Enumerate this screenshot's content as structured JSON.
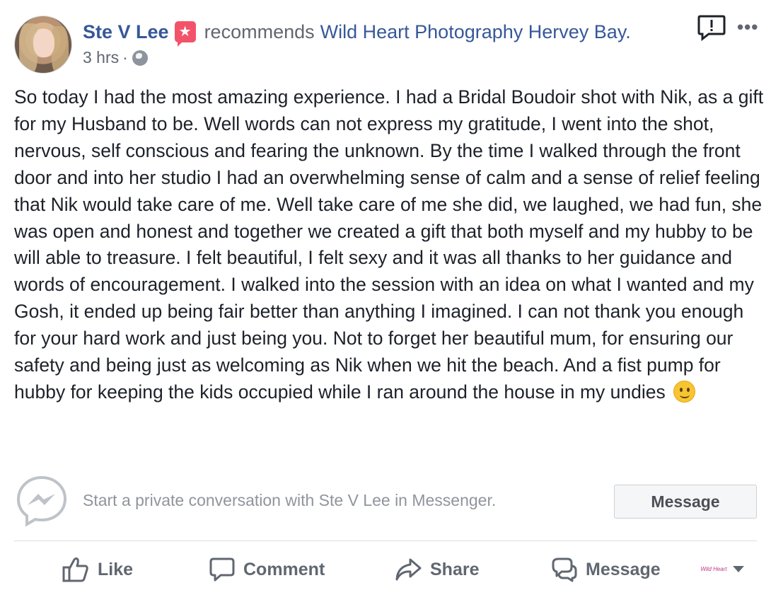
{
  "post": {
    "author": "Ste V Lee",
    "action": "recommends",
    "page": "Wild Heart Photography Hervey Bay.",
    "time": "3 hrs",
    "separator": "·",
    "body": "So today I had the most amazing experience. I had a Bridal Boudoir shot with Nik, as a gift for my Husband to be. Well words can not express my gratitude, I went into the shot, nervous, self conscious and fearing the unknown. By the time I walked through the front door and into her studio I had an overwhelming sense of calm and a sense of relief feeling that Nik would take care of me. Well take care of me she did, we laughed, we had fun, she was open and honest and together we created a gift that both myself and my hubby to be will able to treasure. I felt beautiful, I felt sexy and it was all thanks to her guidance and words of encouragement. I walked into the session with an idea on what I wanted and my Gosh, it ended up being fair better than anything I imagined. I can not thank you enough for your hard work and just being you. Not to forget her beautiful mum, for ensuring our safety and being just as welcoming as Nik when we hit the beach. And a fist pump for hubby for keeping the kids occupied while I ran around the house in my undies",
    "more_label": "•••"
  },
  "messenger": {
    "prompt": "Start a private conversation with Ste V Lee in Messenger.",
    "button": "Message"
  },
  "actions": {
    "like": "Like",
    "comment": "Comment",
    "share": "Share",
    "message": "Message"
  },
  "page_avatar_text": "Wild Heart",
  "colors": {
    "link": "#365899",
    "muted": "#606770",
    "badge": "#f35369",
    "text": "#1d2129"
  },
  "icons": [
    "globe-icon",
    "report-icon",
    "more-icon",
    "messenger-icon",
    "like-icon",
    "comment-icon",
    "share-icon",
    "message-icon",
    "caret-down-icon",
    "smile-emoji"
  ]
}
